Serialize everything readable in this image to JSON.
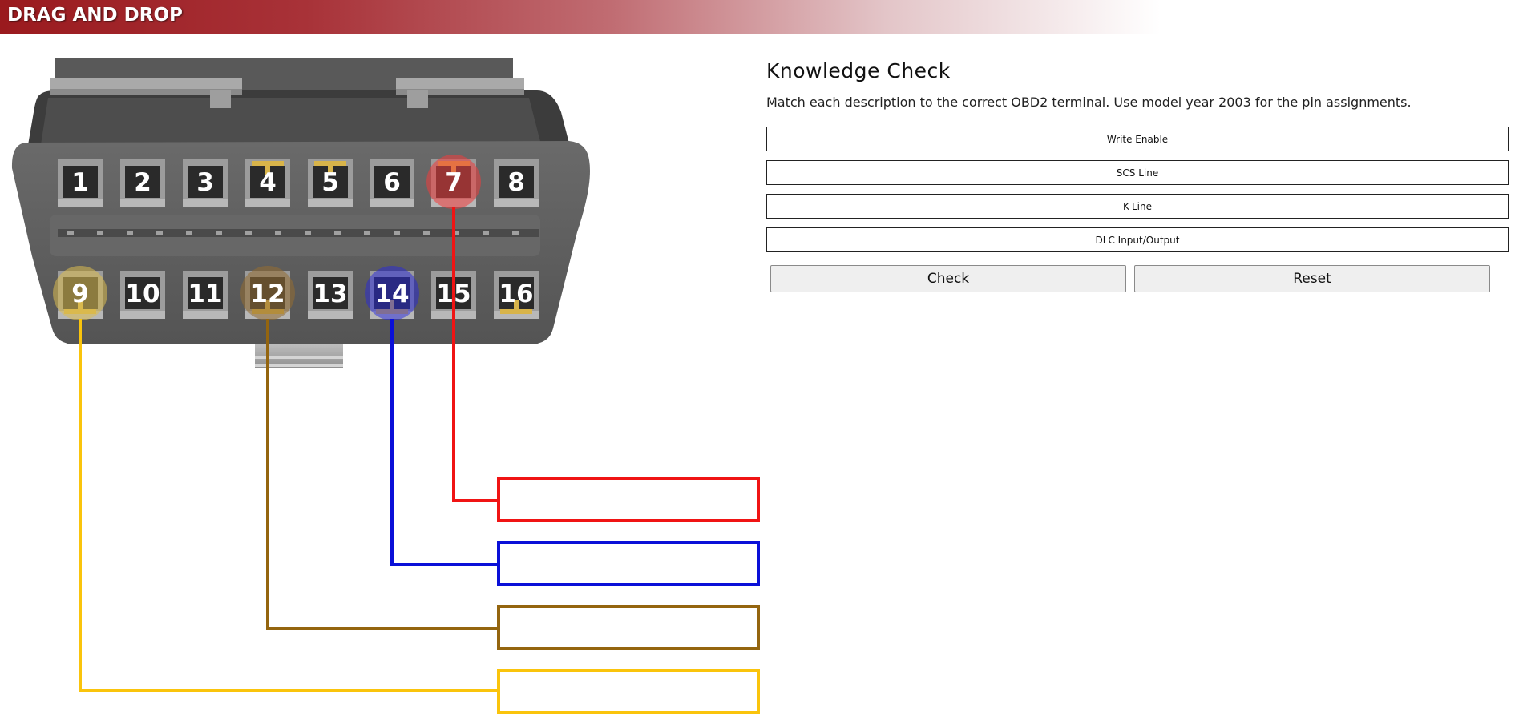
{
  "header": {
    "title": "DRAG AND DROP"
  },
  "connector": {
    "pins_top": [
      "1",
      "2",
      "3",
      "4",
      "5",
      "6",
      "7",
      "8"
    ],
    "pins_bottom": [
      "9",
      "10",
      "11",
      "12",
      "13",
      "14",
      "15",
      "16"
    ]
  },
  "targets": [
    {
      "pin": "7",
      "color": "#f01414",
      "value": ""
    },
    {
      "pin": "14",
      "color": "#0a10d8",
      "value": ""
    },
    {
      "pin": "12",
      "color": "#94650f",
      "value": ""
    },
    {
      "pin": "9",
      "color": "#fac40c",
      "value": ""
    }
  ],
  "knowledge_check": {
    "title": "Knowledge Check",
    "instructions": "Match each description to the correct OBD2 terminal. Use model year 2003 for the pin assignments.",
    "choices": [
      "Write Enable",
      "SCS Line",
      "K-Line",
      "DLC Input/Output"
    ],
    "check_label": "Check",
    "reset_label": "Reset"
  },
  "colors": {
    "header_red": "#9a1a1e",
    "connector_body": "#5a5a5a",
    "highlight_red": "#f01414",
    "highlight_blue": "#0a10d8",
    "highlight_brown": "#94650f",
    "highlight_yellow": "#fac40c",
    "gold_contact": "#d8b44a"
  }
}
